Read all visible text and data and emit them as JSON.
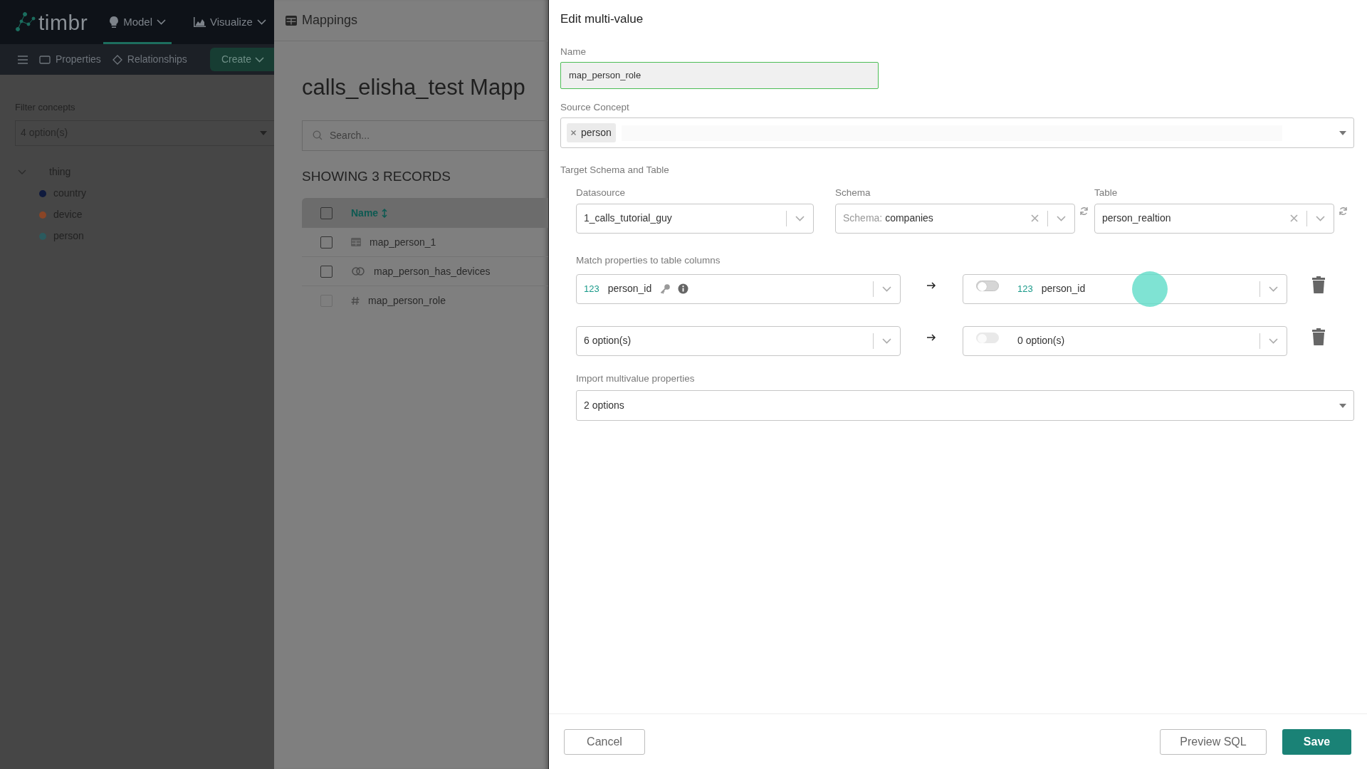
{
  "navbar": {
    "logo": "timbr",
    "menus": [
      {
        "label": "Model",
        "selected": true
      },
      {
        "label": "Visualize",
        "selected": false
      }
    ]
  },
  "toolbar": {
    "items": [
      {
        "label": "Properties",
        "kind": "properties"
      },
      {
        "label": "Relationships",
        "kind": "relationships"
      }
    ],
    "create_button": "Create"
  },
  "sidebar": {
    "filter_label": "Filter concepts",
    "filter_value": "4 option(s)",
    "tree": [
      {
        "label": "thing",
        "expanded": true,
        "children": [
          {
            "label": "country",
            "color": "#0f1a3d"
          },
          {
            "label": "device",
            "color": "#8a4526"
          },
          {
            "label": "person",
            "color": "#2b5a5e"
          }
        ]
      }
    ]
  },
  "mappings": {
    "header": "Mappings",
    "title": "calls_elisha_test Mapp",
    "search_placeholder": "Search...",
    "records": "SHOWING 3 RECORDS",
    "column": "Name",
    "select_all_checked": false,
    "rows": [
      {
        "name": "map_person_1",
        "kind": "table",
        "checked": false,
        "disabled": false
      },
      {
        "name": "map_person_has_devices",
        "kind": "relationship",
        "checked": false,
        "disabled": false
      },
      {
        "name": "map_person_role",
        "kind": "hash",
        "checked": false,
        "disabled": true
      }
    ]
  },
  "dialog": {
    "title": "Edit multi-value",
    "name": {
      "label": "Name",
      "value": "map_person_role"
    },
    "source_concept": {
      "label": "Source Concept",
      "tags": [
        "person"
      ]
    },
    "target": {
      "label": "Target Schema and Table",
      "datasource": {
        "label": "Datasource",
        "value": "1_calls_tutorial_guy"
      },
      "schema": {
        "label": "Schema",
        "prefix": "Schema:",
        "value": "companies"
      },
      "table": {
        "label": "Table",
        "value": "person_realtion"
      }
    },
    "match": {
      "label": "Match properties to table columns",
      "rows": [
        {
          "source": {
            "type": "123",
            "value": "person_id",
            "key": true,
            "info": true
          },
          "target": {
            "toggle_on": false,
            "toggle_disabled": false,
            "type": "123",
            "value": "person_id"
          }
        },
        {
          "source": {
            "value": "6 option(s)",
            "key": false,
            "info": false
          },
          "target": {
            "toggle_on": false,
            "toggle_disabled": true,
            "value": "0 option(s)"
          }
        }
      ]
    },
    "import": {
      "label": "Import multivalue properties",
      "value": "2 options"
    },
    "buttons": {
      "cancel": "Cancel",
      "preview": "Preview SQL",
      "save": "Save"
    }
  }
}
